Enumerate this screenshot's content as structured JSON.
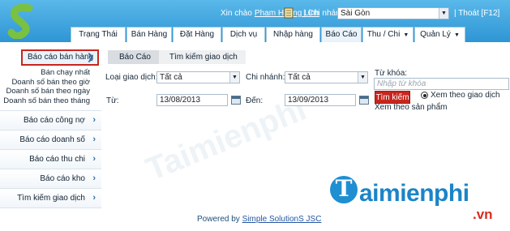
{
  "header": {
    "greeting": "Xin chào",
    "user": "Pham Hoàng Linh",
    "sep1": "|",
    "branch_label": "Chi nhánh:",
    "branch_value": "Sài Gòn",
    "logout": "| Thoát [F12]"
  },
  "nav": {
    "tabs": [
      "Trạng Thái",
      "Bán Hàng",
      "Đặt Hàng",
      "Dịch vụ",
      "Nhập hàng",
      "Báo Cáo",
      "Thu / Chi",
      "Quản Lý"
    ]
  },
  "sidebar": {
    "header": "Báo cáo bán hàng",
    "subitems": [
      "Bán chạy nhất",
      "Doanh số bán theo giờ",
      "Doanh số bán theo ngày",
      "Doanh số bán theo tháng"
    ],
    "items": [
      "Báo cáo công nợ",
      "Báo cáo doanh số",
      "Báo cáo thu chi",
      "Báo cáo kho",
      "Tìm kiếm giao dịch"
    ]
  },
  "breadcrumb": [
    "Báo Cáo",
    "Tìm kiếm giao dịch"
  ],
  "form": {
    "transaction_type_label": "Loại giao dịch:",
    "transaction_type_value": "Tất cả",
    "branch_label": "Chi nhánh:",
    "branch_value": "Tất cả",
    "keyword_label": "Từ khóa:",
    "keyword_placeholder": "Nhập từ khóa",
    "from_label": "Từ:",
    "from_value": "13/08/2013",
    "to_label": "Đến:",
    "to_value": "13/09/2013",
    "search_button": "Tìm kiếm",
    "radio_transaction": "Xem theo giao dịch",
    "radio_product": "Xem theo sản phẩm"
  },
  "footer": {
    "powered_by": "Powered by",
    "brand": "Simple SolutionS JSC"
  },
  "watermark": {
    "text": "aimienphi",
    "suffix": ".vn",
    "faint": "Taimienphi"
  },
  "colors": {
    "header_bg": "#2e95d4",
    "accent_red": "#c7261e",
    "link_blue": "#2456a4"
  }
}
